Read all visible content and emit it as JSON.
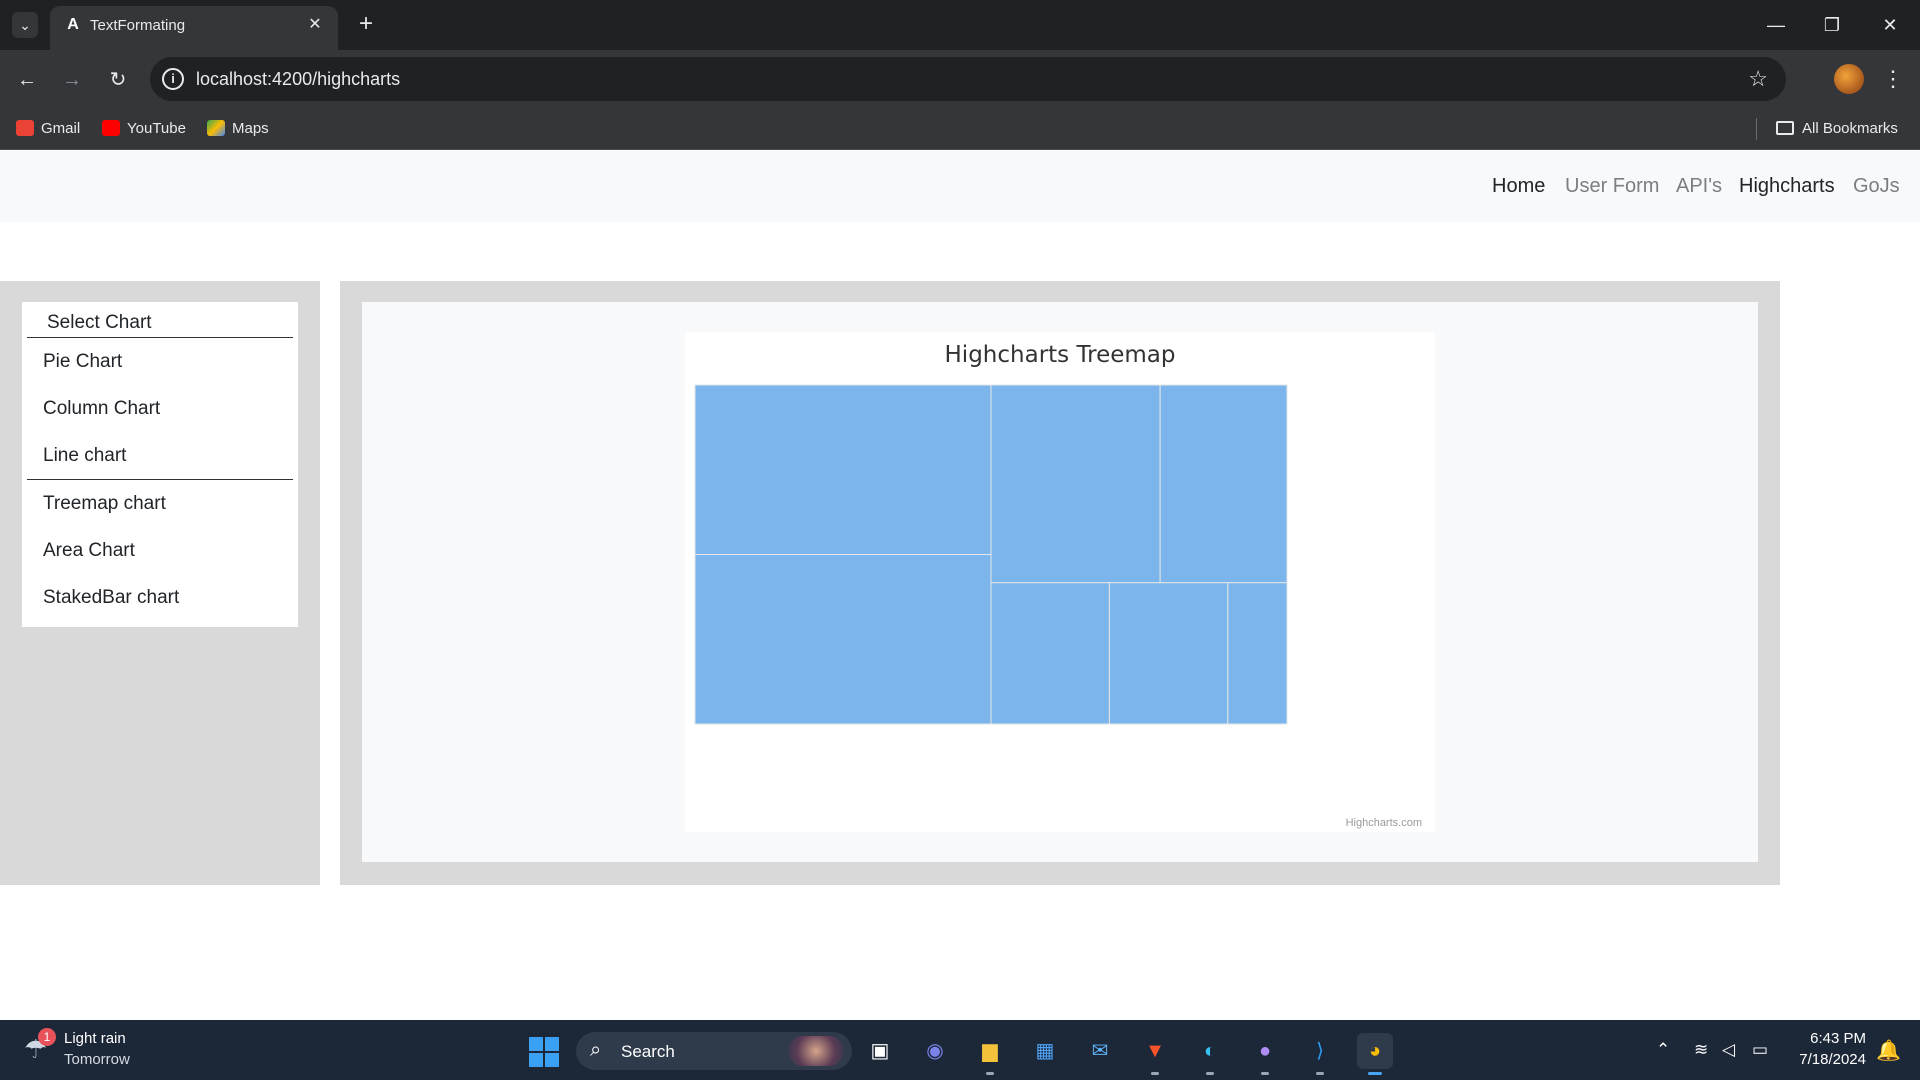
{
  "browser": {
    "tab_title": "TextFormating",
    "tab_favicon": "A",
    "url": "localhost:4200/highcharts",
    "bookmarks": [
      {
        "label": "Gmail",
        "icon": "gmail-icon",
        "color": "#ea4335"
      },
      {
        "label": "YouTube",
        "icon": "youtube-icon",
        "color": "#ff0000"
      },
      {
        "label": "Maps",
        "icon": "maps-icon",
        "color": "#34a853"
      }
    ],
    "all_bookmarks": "All Bookmarks"
  },
  "navbar": {
    "links": [
      {
        "label": "Home",
        "active": true
      },
      {
        "label": "User Form",
        "active": false
      },
      {
        "label": "API's",
        "active": false
      },
      {
        "label": "Highcharts",
        "active": true
      },
      {
        "label": "GoJs",
        "active": false
      }
    ]
  },
  "sidebar": {
    "header": "Select Chart",
    "items": [
      {
        "label": "Pie Chart"
      },
      {
        "label": "Column Chart"
      },
      {
        "label": "Line chart"
      },
      {
        "label": "Treemap chart"
      },
      {
        "label": "Area Chart"
      },
      {
        "label": "StakedBar chart"
      }
    ]
  },
  "chart_data": {
    "type": "treemap",
    "title": "Highcharts Treemap",
    "credits": "Highcharts.com",
    "color": "#7cb5ec",
    "layout": "sliceAndDice",
    "values": [
      6,
      6,
      4,
      3,
      2,
      2,
      1
    ]
  },
  "taskbar": {
    "weather_main": "Light rain",
    "weather_sub": "Tomorrow",
    "weather_badge": "1",
    "search_placeholder": "Search",
    "time": "6:43 PM",
    "date": "7/18/2024",
    "apps": [
      "task-view-icon",
      "meet-icon",
      "file-explorer-icon",
      "store-icon",
      "mail-icon",
      "brave-icon",
      "edge-icon",
      "github-icon",
      "vscode-icon",
      "chrome-icon"
    ]
  }
}
